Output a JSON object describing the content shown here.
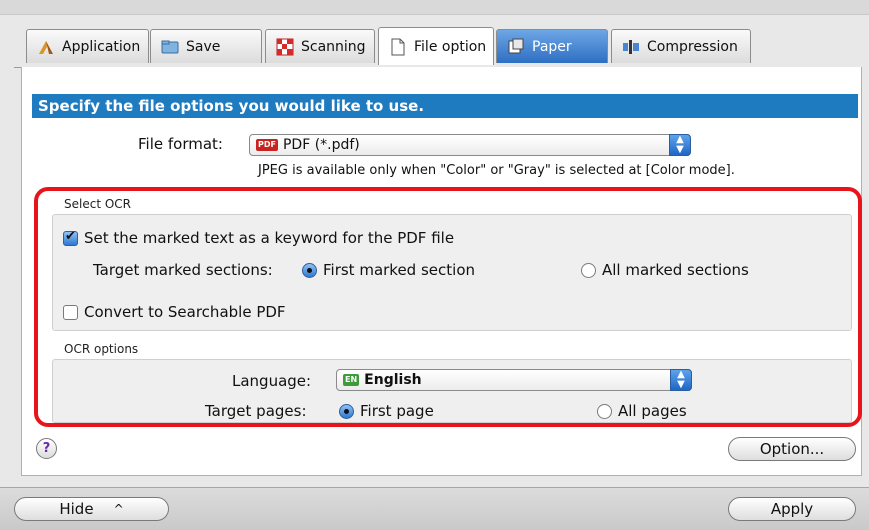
{
  "tabs": [
    {
      "label": "Application",
      "icon": "application-icon"
    },
    {
      "label": "Save",
      "icon": "save-folder-icon"
    },
    {
      "label": "Scanning",
      "icon": "scanning-icon"
    },
    {
      "label": "File option",
      "icon": "file-option-icon",
      "active": true
    },
    {
      "label": "Paper",
      "icon": "paper-icon"
    },
    {
      "label": "Compression",
      "icon": "compression-icon"
    }
  ],
  "heading": "Specify the file options you would like to use.",
  "file_format": {
    "label": "File format:",
    "badge": "PDF",
    "value": "PDF (*.pdf)",
    "note": "JPEG is available only when \"Color\" or \"Gray\" is selected at [Color mode]."
  },
  "select_ocr": {
    "group_label": "Select OCR",
    "keyword_checkbox": "Set the marked text as a keyword for the PDF file",
    "target_sections_label": "Target marked sections:",
    "first_marked": "First marked section",
    "all_marked": "All marked sections",
    "searchable_checkbox": "Convert to Searchable PDF"
  },
  "ocr_options": {
    "group_label": "OCR options",
    "language_label": "Language:",
    "language_badge": "EN",
    "language_value": "English",
    "target_pages_label": "Target pages:",
    "first_page": "First page",
    "all_pages": "All pages"
  },
  "buttons": {
    "help": "?",
    "option": "Option...",
    "hide": "Hide",
    "apply": "Apply"
  },
  "colors": {
    "heading_bg": "#1f7bc0",
    "highlight_border": "#e8141b"
  }
}
